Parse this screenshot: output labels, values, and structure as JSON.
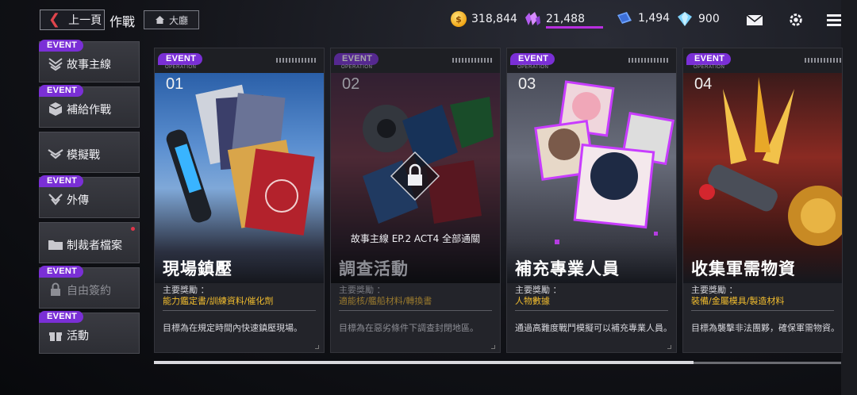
{
  "header": {
    "back_label": "上一頁",
    "title": "作戰",
    "home_label": "大廳"
  },
  "resources": {
    "gold": "318,844",
    "crystal": "21,488",
    "ticket": "1,494",
    "gem": "900"
  },
  "event_tag": "EVENT",
  "operation_label": "OPERATION",
  "sidebar": {
    "items": [
      {
        "label": "故事主線",
        "event": true,
        "icon": "story-icon"
      },
      {
        "label": "補給作戰",
        "event": true,
        "icon": "supply-box-icon"
      },
      {
        "label": "模擬戰",
        "event": false,
        "icon": "simulation-icon"
      },
      {
        "label": "外傳",
        "event": true,
        "icon": "side-story-icon"
      },
      {
        "label": "制裁者檔案",
        "event": false,
        "icon": "folder-icon",
        "notice": true
      },
      {
        "label": "自由簽約",
        "event": true,
        "icon": "lock-icon",
        "locked": true
      },
      {
        "label": "活動",
        "event": true,
        "icon": "gift-icon"
      }
    ]
  },
  "cards": [
    {
      "num": "01",
      "title": "現場鎮壓",
      "reward_label": "主要獎勵 ：",
      "rewards": "能力鑑定書/訓練資料/催化劑",
      "desc": "目標為在規定時間內快速鎮壓現場。",
      "locked": false
    },
    {
      "num": "02",
      "title": "調查活動",
      "reward_label": "主要獎勵 ：",
      "rewards": "適能核/艦船材料/轉換書",
      "desc": "目標為在惡劣條件下調查封閉地區。",
      "locked": true,
      "lock_text": "故事主線 EP.2 ACT4 全部通關"
    },
    {
      "num": "03",
      "title": "補充專業人員",
      "reward_label": "主要獎勵 ：",
      "rewards": "人物數據",
      "desc": "通過高難度戰鬥模擬可以補充專業人員。",
      "locked": false
    },
    {
      "num": "04",
      "title": "收集軍需物資",
      "reward_label": "主要獎勵 ：",
      "rewards": "裝備/金屬模具/製造材料",
      "desc": "目標為襲擊非法團夥，確保軍需物資。",
      "locked": false
    }
  ],
  "colors": {
    "event": "#7a2fd6",
    "reward": "#f2bd2e",
    "accent_red": "#e0454c"
  }
}
